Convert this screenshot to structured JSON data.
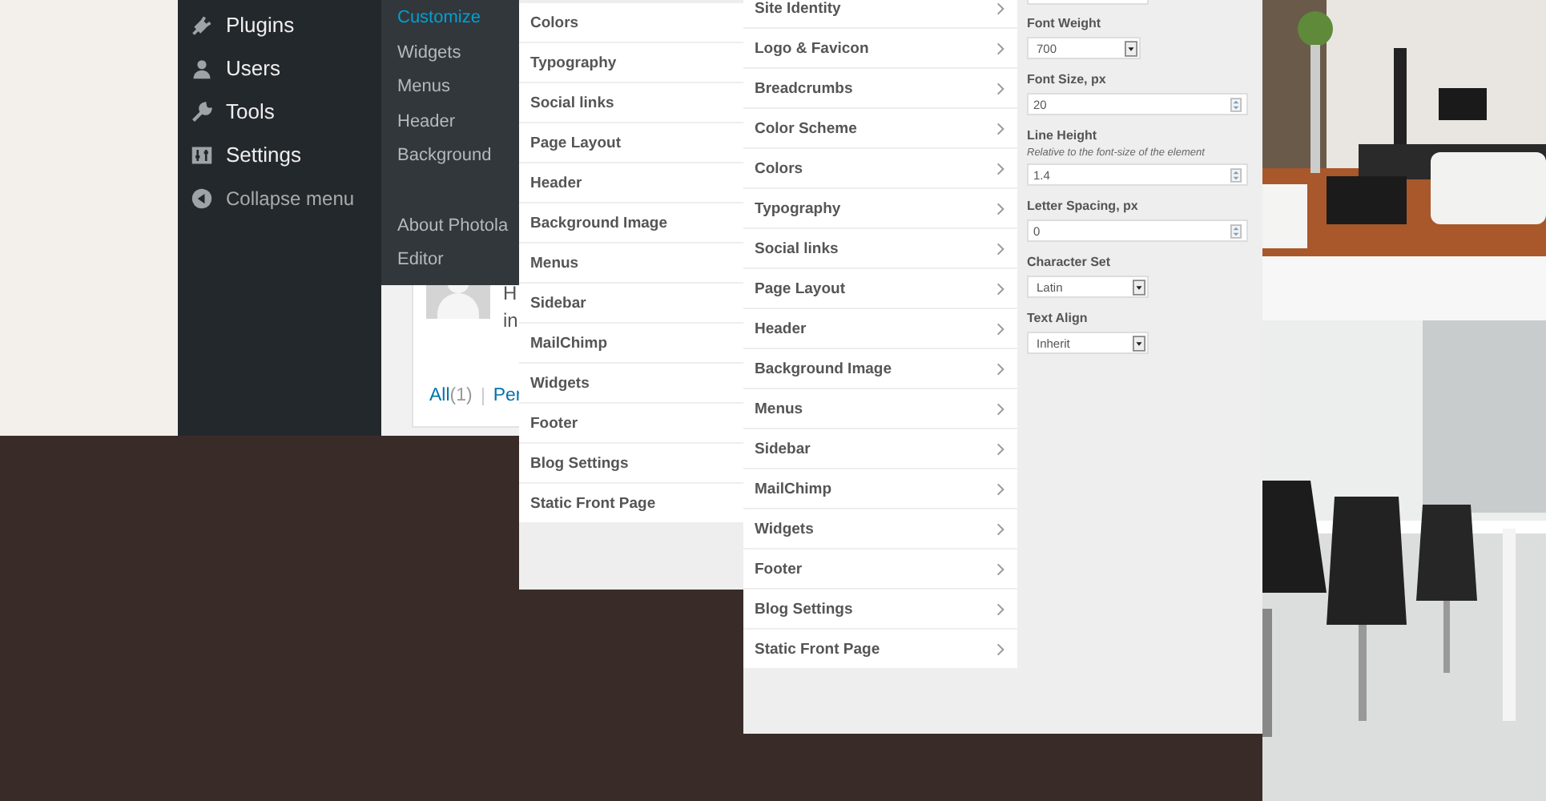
{
  "admin_menu": {
    "items": [
      {
        "label": "Plugins"
      },
      {
        "label": "Users"
      },
      {
        "label": "Tools"
      },
      {
        "label": "Settings"
      },
      {
        "label": "Collapse menu"
      }
    ]
  },
  "submenu": {
    "groups": [
      [
        {
          "label": "Customize",
          "selected": true
        },
        {
          "label": "Widgets",
          "selected": false
        },
        {
          "label": "Menus",
          "selected": false
        },
        {
          "label": "Header",
          "selected": false
        },
        {
          "label": "Background",
          "selected": false
        }
      ],
      [
        {
          "label": "About Photola",
          "selected": false
        },
        {
          "label": "Editor",
          "selected": false
        }
      ]
    ]
  },
  "comment_card": {
    "text_lines": [
      "H",
      "in"
    ],
    "filters": [
      {
        "label": "All",
        "count": "(1)"
      },
      {
        "label": "Per"
      }
    ]
  },
  "customizer_back": {
    "sections": [
      "Colors",
      "Typography",
      "Social links",
      "Page Layout",
      "Header",
      "Background Image",
      "Menus",
      "Sidebar",
      "MailChimp",
      "Widgets",
      "Footer",
      "Blog Settings",
      "Static Front Page"
    ]
  },
  "customizer_front": {
    "sections": [
      "Site Identity",
      "Logo & Favicon",
      "Breadcrumbs",
      "Color Scheme",
      "Colors",
      "Typography",
      "Social links",
      "Page Layout",
      "Header",
      "Background Image",
      "Menus",
      "Sidebar",
      "MailChimp",
      "Widgets",
      "Footer",
      "Blog Settings",
      "Static Front Page"
    ]
  },
  "typography_controls": [
    {
      "kind": "select",
      "label": "Font Weight",
      "value": "700"
    },
    {
      "kind": "number",
      "label": "Font Size, px",
      "value": "20"
    },
    {
      "kind": "number",
      "label": "Line Height",
      "description": "Relative to the font-size of the element",
      "value": "1.4"
    },
    {
      "kind": "number",
      "label": "Letter Spacing, px",
      "value": "0"
    },
    {
      "kind": "select",
      "label": "Character Set",
      "value": "Latin"
    },
    {
      "kind": "select",
      "label": "Text Align",
      "value": "Inherit"
    }
  ]
}
